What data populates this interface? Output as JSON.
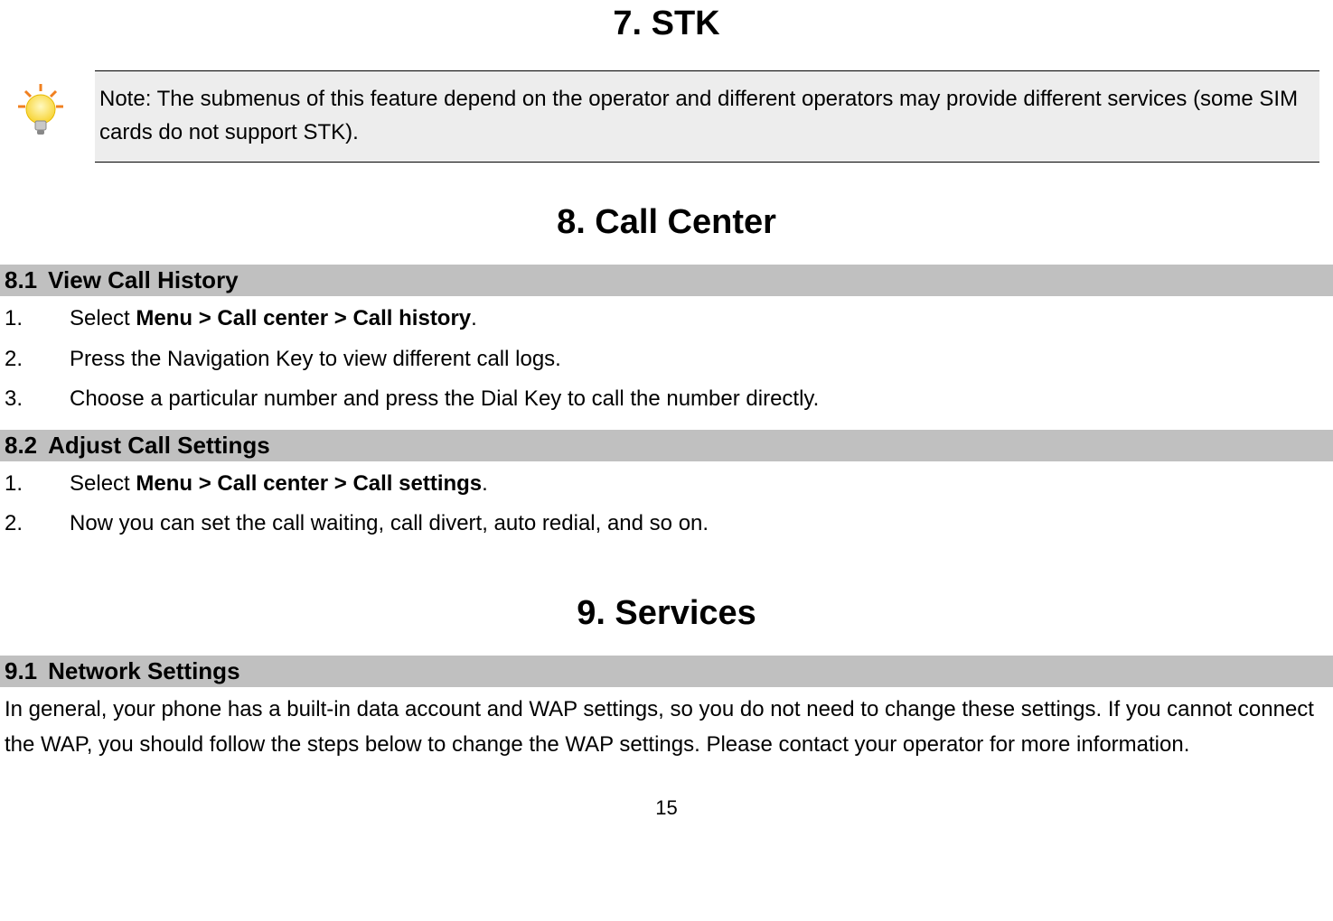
{
  "section7": {
    "heading": "7.    STK",
    "note": "Note: The submenus of this feature depend on the operator and different operators may provide different services (some SIM cards do not support STK)."
  },
  "section8": {
    "heading": "8.    Call Center",
    "sub1": {
      "num": "8.1",
      "title": "View Call History",
      "steps": [
        {
          "n": "1.",
          "pre": "Select ",
          "bold": "Menu > Call center > Call history",
          "post": "."
        },
        {
          "n": "2.",
          "text": "Press the Navigation Key to view different call logs."
        },
        {
          "n": "3.",
          "text": "Choose a particular number and press the Dial Key to call the number directly."
        }
      ]
    },
    "sub2": {
      "num": "8.2",
      "title": "Adjust Call Settings",
      "steps": [
        {
          "n": "1.",
          "pre": "Select ",
          "bold": "Menu > Call center > Call settings",
          "post": "."
        },
        {
          "n": "2.",
          "text": "Now you can set the call waiting, call divert, auto redial, and so on."
        }
      ]
    }
  },
  "section9": {
    "heading": "9.    Services",
    "sub1": {
      "num": "9.1",
      "title": "Network Settings",
      "para": "In general, your phone has a built-in data account and WAP settings, so you do not need to change these settings. If you cannot connect the WAP, you should follow the steps below to change the WAP settings. Please contact your operator for more information."
    }
  },
  "pagenum": "15"
}
